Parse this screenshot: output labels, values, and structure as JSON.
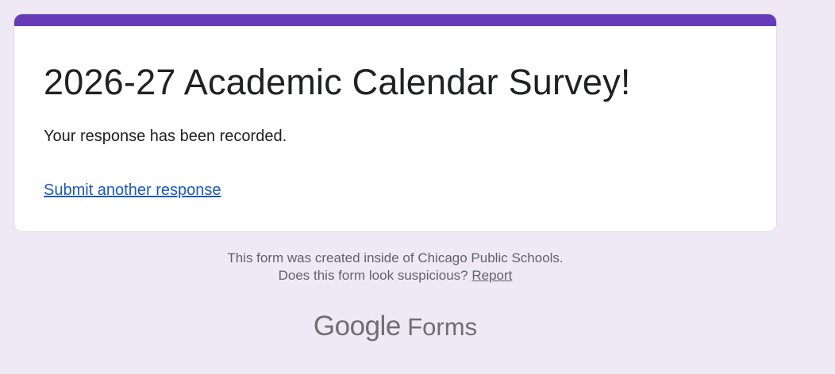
{
  "form": {
    "title": "2026-27 Academic Calendar Survey!",
    "confirmation_message": "Your response has been recorded.",
    "submit_another_label": "Submit another response"
  },
  "footer": {
    "created_inside": "This form was created inside of Chicago Public Schools.",
    "suspicious_prompt": "Does this form look suspicious?",
    "report_label": "Report"
  },
  "brand": {
    "google": "Google",
    "forms": "Forms"
  },
  "colors": {
    "accent": "#673ab7",
    "background": "#efe9f6",
    "link": "#1a56c8"
  }
}
